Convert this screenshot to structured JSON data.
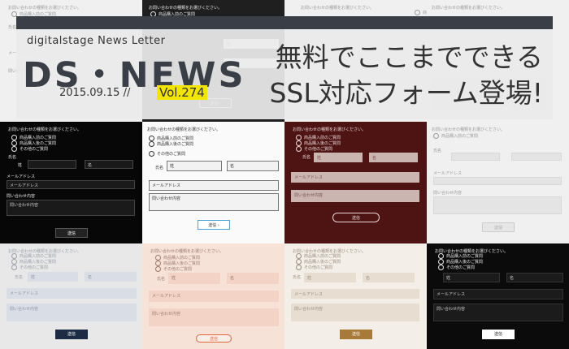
{
  "banner": {
    "tagline": "digitalstage News Letter",
    "logo": "DS・NEWS",
    "date": "2015.09.15 //",
    "volume": "Vol.274",
    "headline_line1": "無料でここまでできる",
    "headline_line2": "SSL対応フォーム登場!"
  },
  "form": {
    "question": "お問い合わせの種類をお選びください。",
    "options": [
      "商品購入前のご質問",
      "商品購入後のご質問",
      "その他のご質問"
    ],
    "name_label": "氏名",
    "last_name": "姓",
    "first_name": "名",
    "email_label": "メールアドレス",
    "inquiry_label": "問い合わせ内容",
    "submit": "送信"
  },
  "colors": {
    "banner_bar": "#3a3f47",
    "volume_highlight": "#f2e600"
  }
}
